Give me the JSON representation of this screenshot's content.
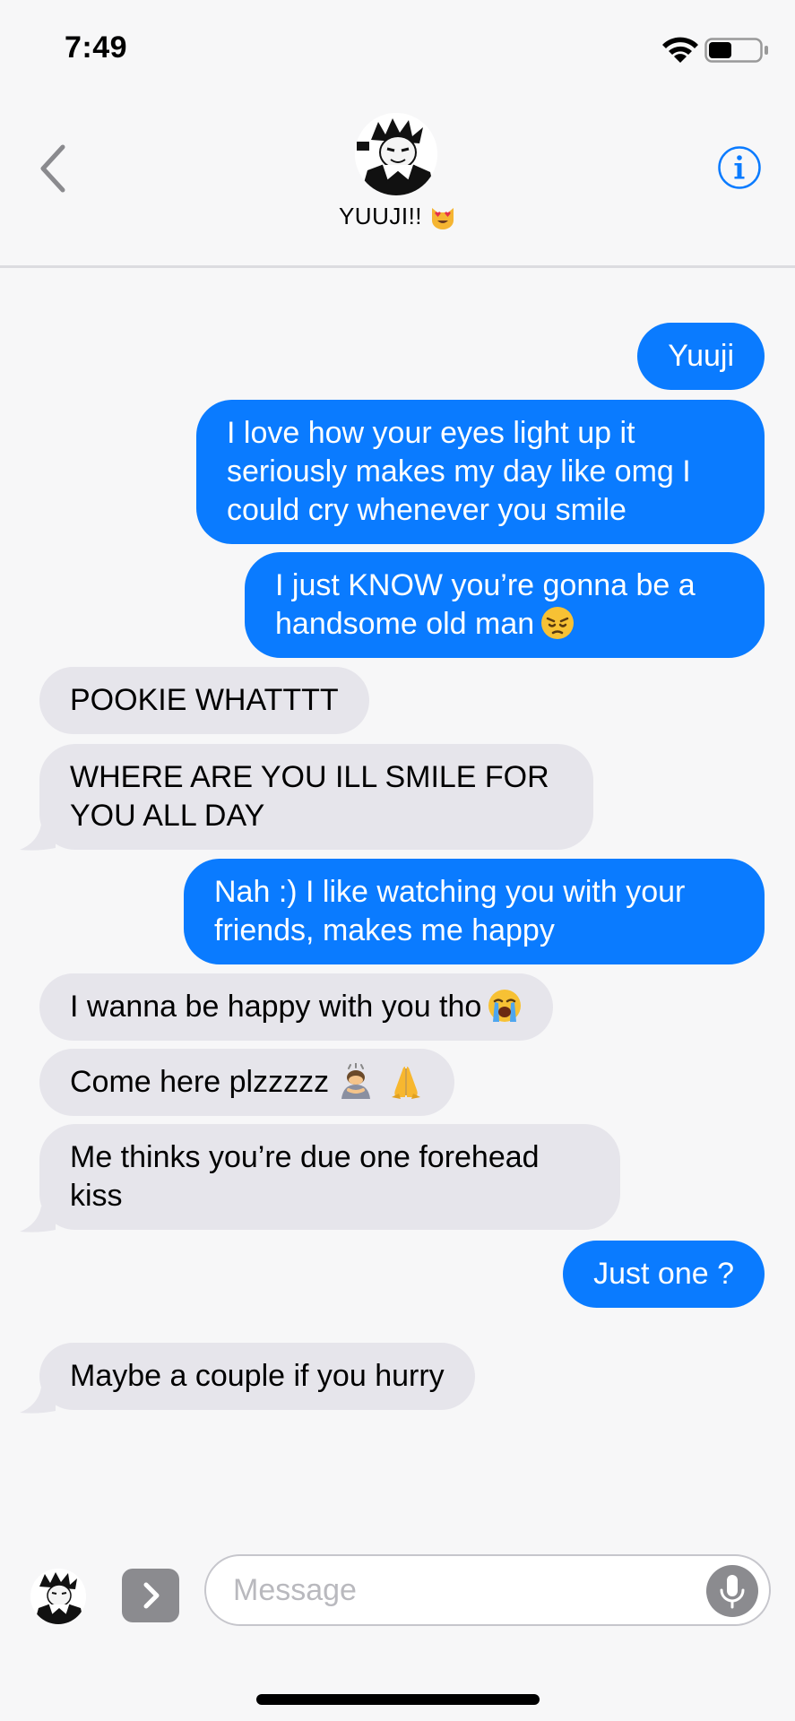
{
  "status_bar": {
    "time": "7:49",
    "wifi_icon": "wifi-icon",
    "battery_icon": "battery-icon",
    "battery_level": 0.45
  },
  "header": {
    "back_icon": "chevron-left-icon",
    "contact_name": "YUUJI!!",
    "contact_emoji": "heart-eyes-cat-emoji",
    "info_icon": "info-icon",
    "accent_color": "#0a7bff"
  },
  "messages": [
    {
      "direction": "sent",
      "text": "Yuuji"
    },
    {
      "direction": "sent",
      "text": "I love how your eyes light up it seriously makes my day like omg I could cry whenever you smile"
    },
    {
      "direction": "sent",
      "text": "I just KNOW you’re gonna be a handsome old man",
      "emoji": "pensive-face-emoji"
    },
    {
      "direction": "received",
      "text": "POOKIE WHATTTT"
    },
    {
      "direction": "received",
      "text": "WHERE ARE YOU ILL SMILE FOR YOU ALL DAY"
    },
    {
      "direction": "sent",
      "text": "Nah :) I like watching you with your friends, makes me happy"
    },
    {
      "direction": "received",
      "text": "I wanna be happy with you tho",
      "emoji": "loudly-crying-face-emoji"
    },
    {
      "direction": "received",
      "text": "Come here plzzzzz",
      "emoji": "bowing-person-and-folded-hands-emoji"
    },
    {
      "direction": "received",
      "text": "Me thinks you’re due one forehead kiss"
    },
    {
      "direction": "sent",
      "text": "Just one ?"
    },
    {
      "direction": "received",
      "text": "Maybe a couple if you hurry"
    }
  ],
  "colors": {
    "sent_bubble": "#0a7bff",
    "received_bubble": "#e6e5eb",
    "background": "#f7f7f8"
  },
  "input_bar": {
    "placeholder": "Message",
    "value": "",
    "expand_icon": "chevron-right-icon",
    "mic_icon": "microphone-icon",
    "app_icon": "avatar-app-icon"
  }
}
